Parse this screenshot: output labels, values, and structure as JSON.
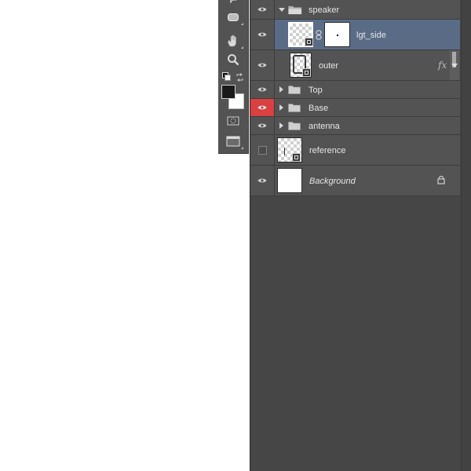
{
  "tools": [
    {
      "icon": "rounded-rectangle-tool-icon"
    },
    {
      "icon": "hand-tool-icon"
    },
    {
      "icon": "zoom-tool-icon"
    },
    {
      "icon": "default-colors-icon"
    },
    {
      "icon": "swap-colors-icon"
    },
    {
      "icon": "foreground-color-swatch",
      "color": "#1a1a1a"
    },
    {
      "icon": "background-color-swatch",
      "color": "#ffffff"
    },
    {
      "icon": "quick-mask-icon"
    },
    {
      "icon": "screen-mode-icon"
    }
  ],
  "layers": [
    {
      "name": "speaker",
      "type": "group",
      "expanded": true,
      "visible": true
    },
    {
      "name": "lgt_side",
      "type": "smart-object-with-mask",
      "selected": true,
      "visible": true
    },
    {
      "name": "outer",
      "type": "smart-object",
      "visible": true,
      "effects_icon": "fx"
    },
    {
      "name": "Top",
      "type": "group",
      "expanded": false,
      "visible": true
    },
    {
      "name": "Base",
      "type": "group",
      "expanded": false,
      "visible": true,
      "color_label": "#d9403f"
    },
    {
      "name": "antenna",
      "type": "group",
      "expanded": false,
      "visible": true
    },
    {
      "name": "reference",
      "type": "smart-object",
      "visible": false
    },
    {
      "name": "Background",
      "type": "background",
      "visible": true,
      "locked": true
    }
  ],
  "colors": {
    "panel_bg": "#464646",
    "row_bg": "#535353",
    "selected_row_bg": "#5a6b85",
    "label_red": "#d9403f"
  }
}
